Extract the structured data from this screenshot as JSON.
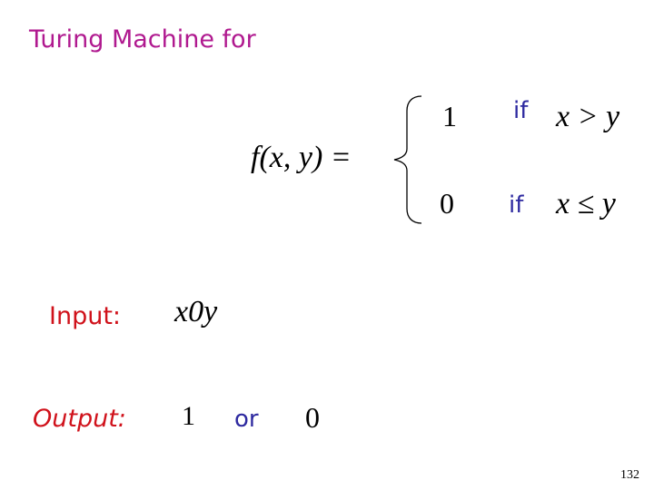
{
  "slide": {
    "title": "Turing Machine for",
    "function_definition": {
      "lhs": "f(x, y) =",
      "cases": [
        {
          "value": "1",
          "keyword": "if",
          "condition": "x > y"
        },
        {
          "value": "0",
          "keyword": "if",
          "condition": "x ≤ y"
        }
      ]
    },
    "input": {
      "label": "Input:",
      "value": "x0y"
    },
    "output": {
      "label": "Output:",
      "value_a": "1",
      "connector": "or",
      "value_b": "0"
    },
    "page_number": "132"
  },
  "colors": {
    "title": "#b0198f",
    "labels": "#d0121b",
    "keywords": "#2e2aa0",
    "math": "#000000"
  }
}
